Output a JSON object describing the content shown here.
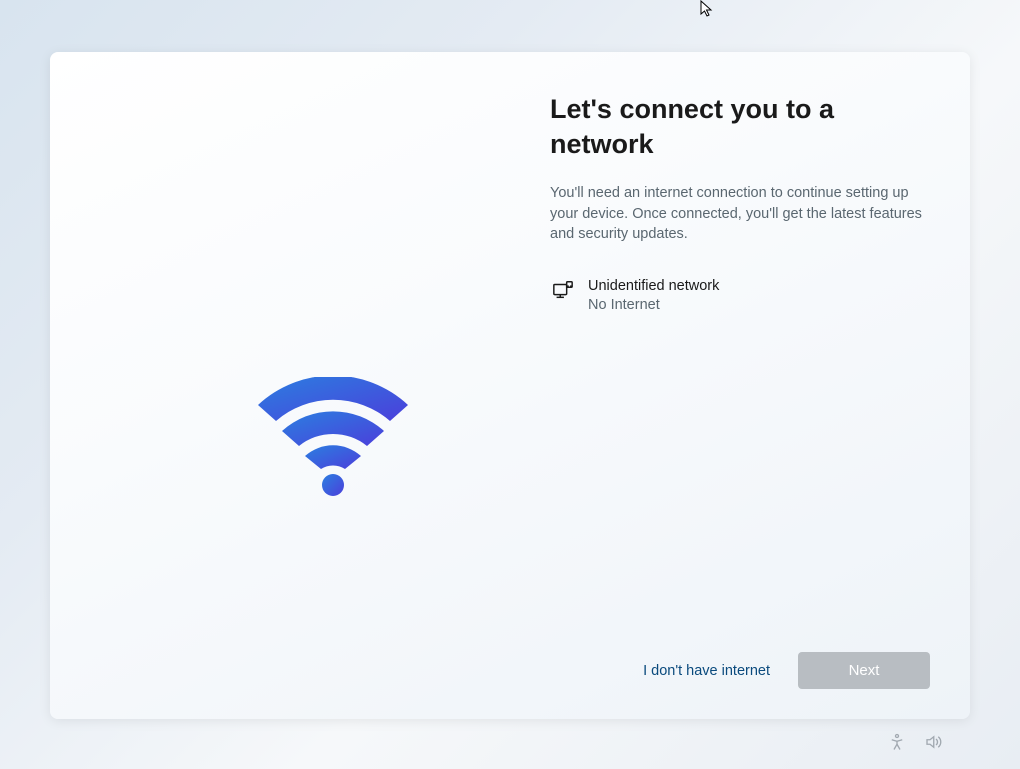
{
  "title": "Let's connect you to a network",
  "description": "You'll need an internet connection to continue setting up your device. Once connected, you'll get the latest features and security updates.",
  "network": {
    "name": "Unidentified network",
    "status": "No Internet"
  },
  "buttons": {
    "skip": "I don't have internet",
    "next": "Next"
  }
}
